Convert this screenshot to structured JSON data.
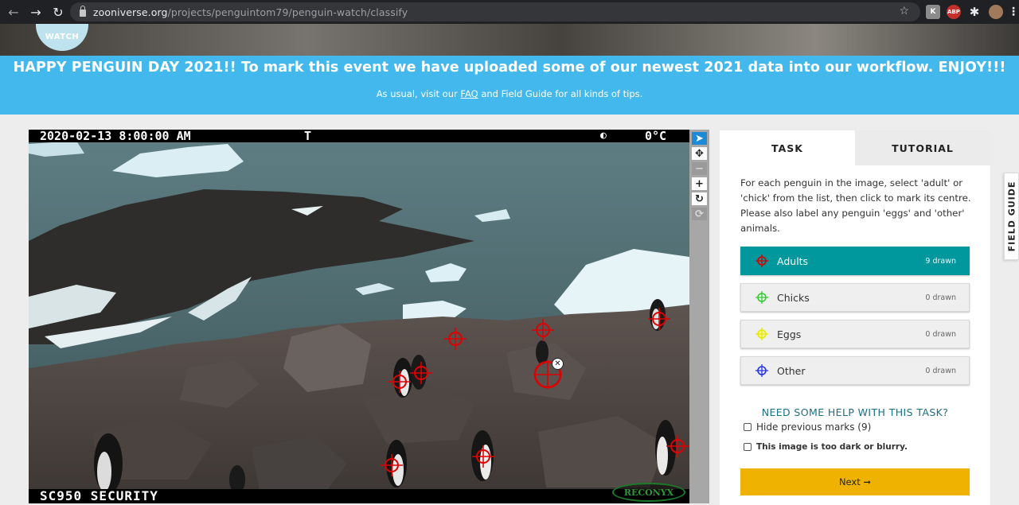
{
  "browser": {
    "url_host": "zooniverse.org",
    "url_path": "/projects/penguintom79/penguin-watch/classify",
    "extensions": [
      "K",
      "ABP"
    ]
  },
  "logo": {
    "text": "WATCH"
  },
  "banner": {
    "headline": "HAPPY PENGUIN DAY 2021!! To mark this event we have uploaded some of our newest 2021 data into our workflow. ENJOY!!!",
    "sub_prefix": "As usual, visit our ",
    "faq_link": "FAQ",
    "sub_suffix": " and Field Guide for all kinds of tips."
  },
  "camera": {
    "datetime": "2020-02-13 8:00:00 AM",
    "temp_flag": "T",
    "moon_icon": "half-moon-icon",
    "temperature": "0°C",
    "model": "SC950 SECURITY",
    "brand": "RECONYX"
  },
  "toolbar": {
    "tools": [
      "pointer-icon",
      "move-icon",
      "zoom-out-icon",
      "zoom-in-icon",
      "rotate-icon",
      "reset-icon"
    ],
    "active": "pointer-icon"
  },
  "marks": {
    "count": 9,
    "color": "#e00000"
  },
  "panel": {
    "tabs": [
      "TASK",
      "TUTORIAL"
    ],
    "active_tab": "TASK",
    "instructions": "For each penguin in the image, select 'adult' or 'chick' from the list, then click to mark its centre. Please also label any penguin 'eggs' and 'other' animals.",
    "tools": [
      {
        "label": "Adults",
        "count": "9 drawn",
        "color": "#d40000",
        "selected": true
      },
      {
        "label": "Chicks",
        "count": "0 drawn",
        "color": "#33cc33",
        "selected": false
      },
      {
        "label": "Eggs",
        "count": "0 drawn",
        "color": "#e8e800",
        "selected": false
      },
      {
        "label": "Other",
        "count": "0 drawn",
        "color": "#2233ee",
        "selected": false
      }
    ],
    "help": "NEED SOME HELP WITH THIS TASK?",
    "hide_marks": "Hide previous marks (9)",
    "too_dark": "This image is too dark or blurry.",
    "next": "Next ➞"
  },
  "field_guide": "FIELD GUIDE"
}
